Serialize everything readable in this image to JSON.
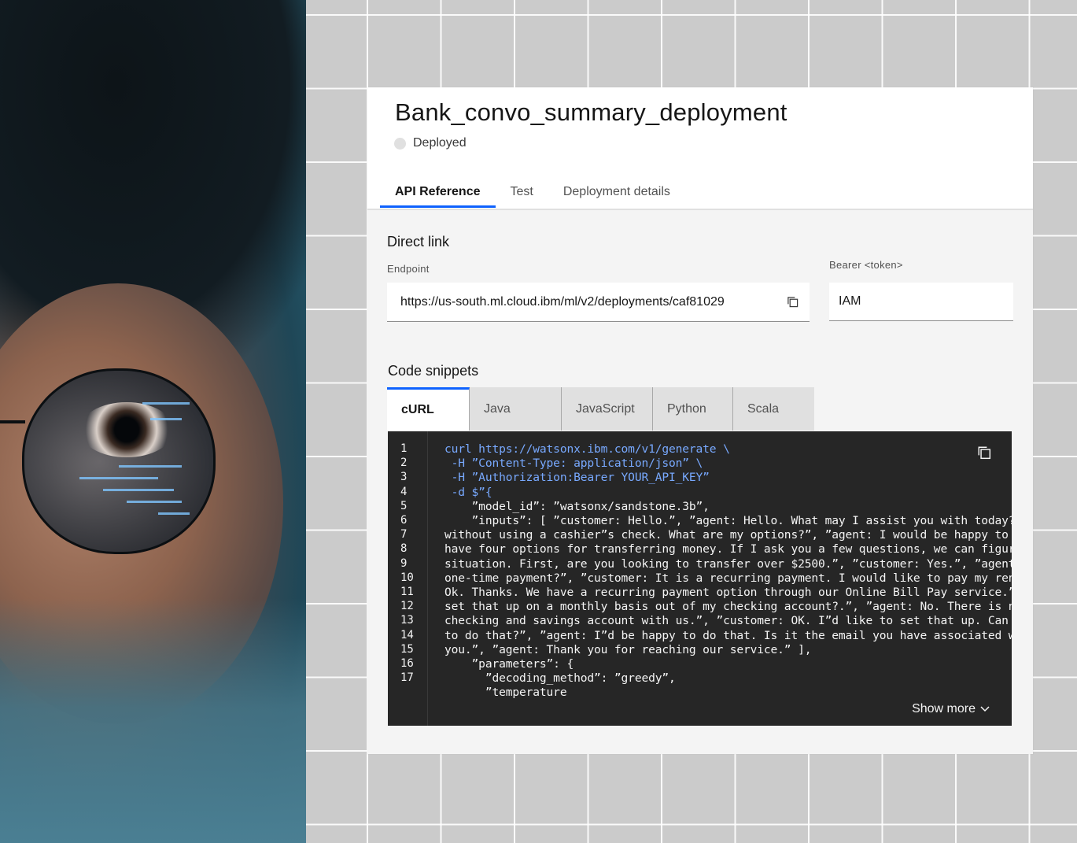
{
  "card": {
    "title": "Bank_convo_summary_deployment",
    "status": "Deployed",
    "tabs": [
      "API Reference",
      "Test",
      "Deployment details"
    ],
    "active_tab": "API Reference"
  },
  "direct_link": {
    "heading": "Direct link",
    "endpoint_label": "Endpoint",
    "endpoint_value": "https://us-south.ml.cloud.ibm/ml/v2/deployments/caf81029",
    "bearer_label": "Bearer <token>",
    "bearer_value": "IAM"
  },
  "code_snippets": {
    "heading": "Code snippets",
    "tabs": [
      "cURL",
      "Java",
      "JavaScript",
      "Python",
      "Scala"
    ],
    "active_tab": "cURL",
    "line_numbers": [
      "1",
      "2",
      "3",
      "4",
      "5",
      "6",
      "7",
      "8",
      "9",
      "10",
      "11",
      "12",
      "13",
      "14",
      "15",
      "16",
      "17"
    ],
    "lines": [
      "curl https://watsonx.ibm.com/v1/generate \\",
      " -H ”Content-Type: application/json” \\",
      " -H ”Authorization:Bearer YOUR_API_KEY”",
      " -d $”{",
      "    ”model_id”: ”watsonx/sandstone.3b”,",
      "    ”inputs”: [ ”customer: Hello.”, ”agent: Hello. What may I assist you with today?",
      "without using a cashier”s check. What are my options?”, ”agent: I would be happy to",
      "have four options for transferring money. If I ask you a few questions, we can figur",
      "situation. First, are you looking to transfer over $2500.”, ”customer: Yes.”, ”agent",
      "one-time payment?”, ”customer: It is a recurring payment. I would like to pay my ren",
      "Ok. Thanks. We have a recurring payment option through our Online Bill Pay service.”",
      "set that up on a monthly basis out of my checking account?.”, ”agent: No. There is n",
      "checking and savings account with us.”, ”customer: OK. I”d like to set that up. Can",
      "to do that?”, ”agent: I”d be happy to do that. Is it the email you have associated w",
      "you.”, ”agent: Thank you for reaching our service.” ],",
      "    ”parameters”: {",
      "      ”decoding_method”: ”greedy”,",
      "      ”temperature"
    ],
    "show_more": "Show more"
  },
  "icons": {
    "copy_endpoint": "copy-icon",
    "copy_code": "copy-icon",
    "chevron": "chevron-down-icon",
    "status": "status-dot-icon"
  },
  "colors": {
    "accent": "#0f62fe",
    "code_bg": "#262626",
    "code_keyword": "#78a9ff"
  }
}
